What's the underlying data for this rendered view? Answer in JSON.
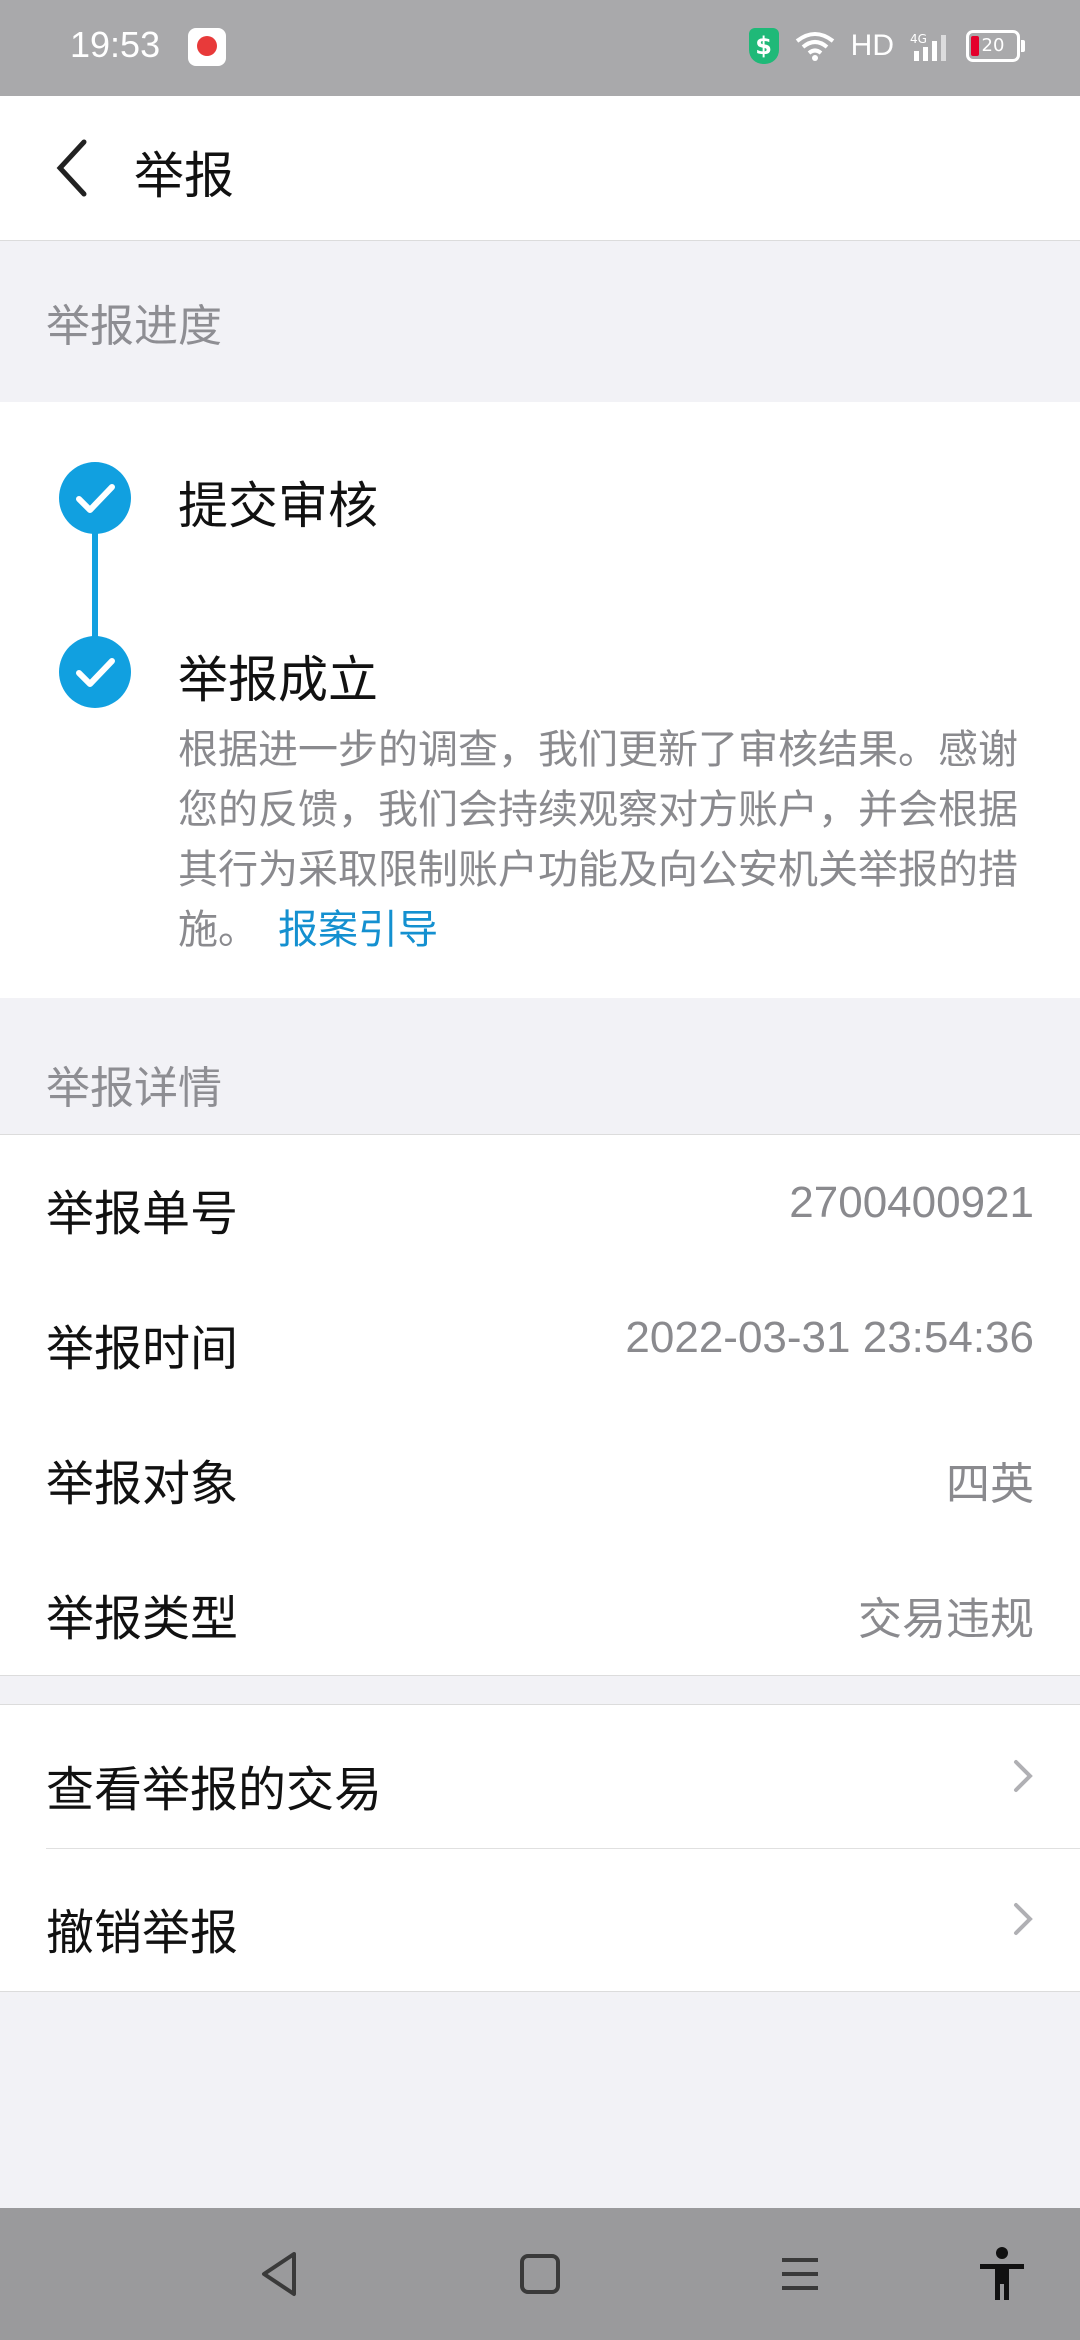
{
  "status_bar": {
    "time": "19:53",
    "network": "HD",
    "signal_label": "4G",
    "battery": "20",
    "icons": [
      "app-notification-icon",
      "shield-icon",
      "wifi-icon",
      "signal-icon",
      "battery-icon"
    ]
  },
  "header": {
    "title": "举报",
    "back_icon": "chevron-left-icon"
  },
  "progress": {
    "section_title": "举报进度",
    "steps": [
      {
        "title": "提交审核",
        "done": true
      },
      {
        "title": "举报成立",
        "done": true,
        "description": "根据进一步的调查，我们更新了审核结果。感谢您的反馈，我们会持续观察对方账户，并会根据其行为采取限制账户功能及向公安机关举报的措施。",
        "link": "报案引导"
      }
    ]
  },
  "details": {
    "section_title": "举报详情",
    "rows": [
      {
        "label": "举报单号",
        "value": "2700400921"
      },
      {
        "label": "举报时间",
        "value": "2022-03-31 23:54:36"
      },
      {
        "label": "举报对象",
        "value": "四英"
      },
      {
        "label": "举报类型",
        "value": "交易违规"
      }
    ]
  },
  "actions": [
    {
      "label": "查看举报的交易"
    },
    {
      "label": "撤销举报"
    }
  ],
  "colors": {
    "accent": "#11a0e0",
    "link": "#1490d0",
    "background": "#f2f2f6",
    "secondary_text": "#8a8a8e"
  },
  "nav_bar": {
    "icons": [
      "back-triangle-icon",
      "home-square-icon",
      "menu-lines-icon",
      "accessibility-icon"
    ]
  }
}
